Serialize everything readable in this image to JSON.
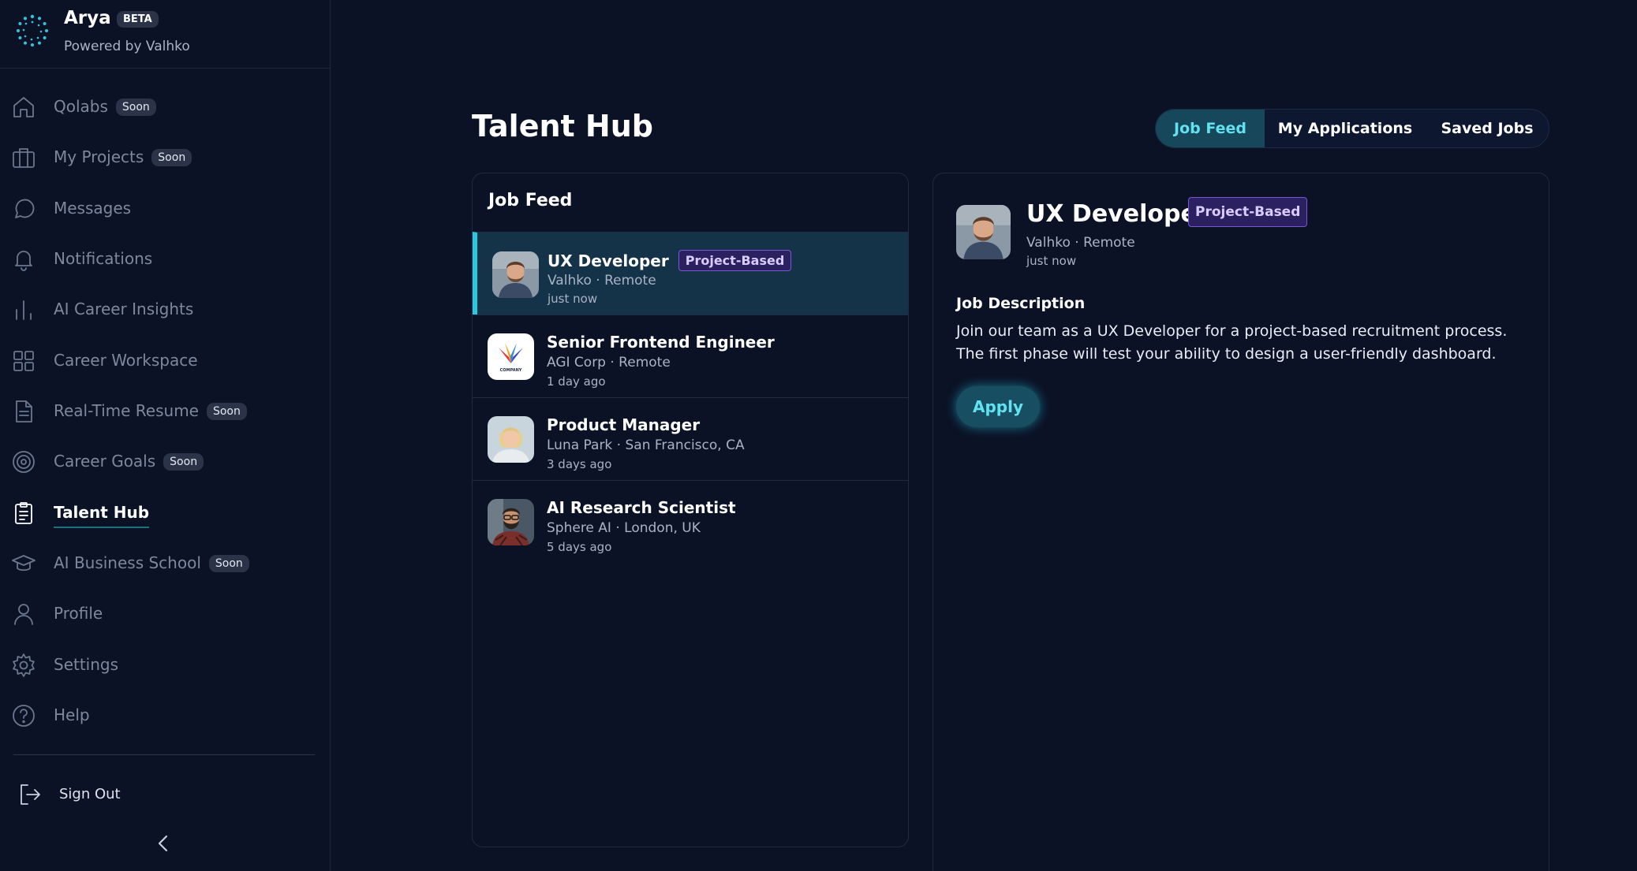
{
  "app": {
    "name": "Arya",
    "badge": "BETA",
    "subtitle": "Powered by Valhko"
  },
  "sidebar": {
    "items": [
      {
        "label": "Qolabs",
        "badge": "Soon",
        "icon": "home-icon"
      },
      {
        "label": "My Projects",
        "badge": "Soon",
        "icon": "briefcase-icon"
      },
      {
        "label": "Messages",
        "badge": "",
        "icon": "chat-bubble-icon"
      },
      {
        "label": "Notifications",
        "badge": "",
        "icon": "bell-icon"
      },
      {
        "label": "AI Career Insights",
        "badge": "",
        "icon": "bar-chart-icon"
      },
      {
        "label": "Career Workspace",
        "badge": "",
        "icon": "grid-icon"
      },
      {
        "label": "Real-Time Resume",
        "badge": "Soon",
        "icon": "document-icon"
      },
      {
        "label": "Career Goals",
        "badge": "Soon",
        "icon": "target-icon"
      },
      {
        "label": "Talent Hub",
        "badge": "",
        "icon": "clipboard-icon",
        "active": true
      },
      {
        "label": "AI Business School",
        "badge": "Soon",
        "icon": "graduation-cap-icon"
      },
      {
        "label": "Profile",
        "badge": "",
        "icon": "user-icon"
      },
      {
        "label": "Settings",
        "badge": "",
        "icon": "gear-icon"
      },
      {
        "label": "Help",
        "badge": "",
        "icon": "help-circle-icon"
      }
    ],
    "sign_out": "Sign Out"
  },
  "main": {
    "title": "Talent Hub",
    "tabs": [
      {
        "label": "Job Feed",
        "active": true
      },
      {
        "label": "My Applications",
        "active": false
      },
      {
        "label": "Saved Jobs",
        "active": false
      }
    ],
    "feed": {
      "title": "Job Feed",
      "jobs": [
        {
          "title": "UX Developer",
          "tag": "Project-Based",
          "company": "Valhko",
          "location": "Remote",
          "meta": "Valhko · Remote",
          "time": "just now",
          "avatar": "man-avatar",
          "selected": true
        },
        {
          "title": "Senior Frontend Engineer",
          "tag": "",
          "company": "AGI Corp",
          "location": "Remote",
          "meta": "AGI Corp · Remote",
          "time": "1 day ago",
          "avatar": "company-logo",
          "logo_text": "COMPANY"
        },
        {
          "title": "Product Manager",
          "tag": "",
          "company": "Luna Park",
          "location": "San Francisco, CA",
          "meta": "Luna Park · San Francisco, CA",
          "time": "3 days ago",
          "avatar": "woman-avatar"
        },
        {
          "title": "AI Research Scientist",
          "tag": "",
          "company": "Sphere AI",
          "location": "London, UK",
          "meta": "Sphere AI · London, UK",
          "time": "5 days ago",
          "avatar": "bearded-man-avatar"
        }
      ]
    },
    "detail": {
      "title": "UX Developer",
      "tag": "Project-Based",
      "meta": "Valhko · Remote",
      "time": "just now",
      "description_heading": "Job Description",
      "description": "Join our team as a UX Developer for a project-based recruitment process. The first phase will test your ability to design a user-friendly dashboard.",
      "apply_label": "Apply"
    }
  },
  "colors": {
    "background": "#0b1226",
    "accent": "#27c8e0",
    "tag_border": "#7b55d6",
    "selected_row": "#153348"
  }
}
